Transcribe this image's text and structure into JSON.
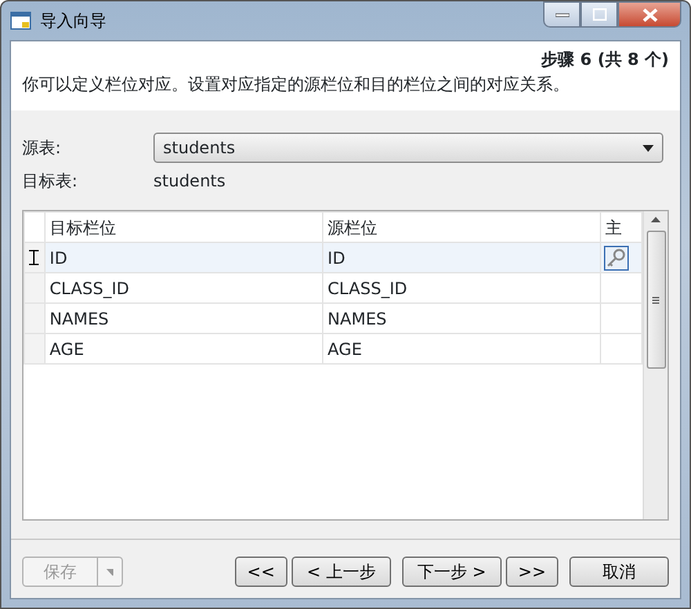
{
  "window": {
    "title": "导入向导"
  },
  "step": "步骤 6 (共 8 个)",
  "description": "你可以定义栏位对应。设置对应指定的源栏位和目的栏位之间的对应关系。",
  "source_table": {
    "label": "源表:",
    "value": "students"
  },
  "target_table": {
    "label": "目标表:",
    "value": "students"
  },
  "table": {
    "columns": [
      "目标栏位",
      "源栏位",
      "主"
    ],
    "rows": [
      {
        "target": "ID",
        "source": "ID",
        "primary_key": true,
        "selected": true
      },
      {
        "target": "CLASS_ID",
        "source": "CLASS_ID",
        "primary_key": false,
        "selected": false
      },
      {
        "target": "NAMES",
        "source": "NAMES",
        "primary_key": false,
        "selected": false
      },
      {
        "target": "AGE",
        "source": "AGE",
        "primary_key": false,
        "selected": false
      }
    ]
  },
  "save_button": {
    "label": "保存",
    "disabled": true
  },
  "buttons": [
    {
      "label": "<<",
      "disabled": false
    },
    {
      "label": "< 上一步",
      "disabled": false
    },
    {
      "label": "下一步 >",
      "disabled": false
    },
    {
      "label": ">>",
      "disabled": false
    },
    {
      "label": "取消",
      "disabled": false
    }
  ]
}
